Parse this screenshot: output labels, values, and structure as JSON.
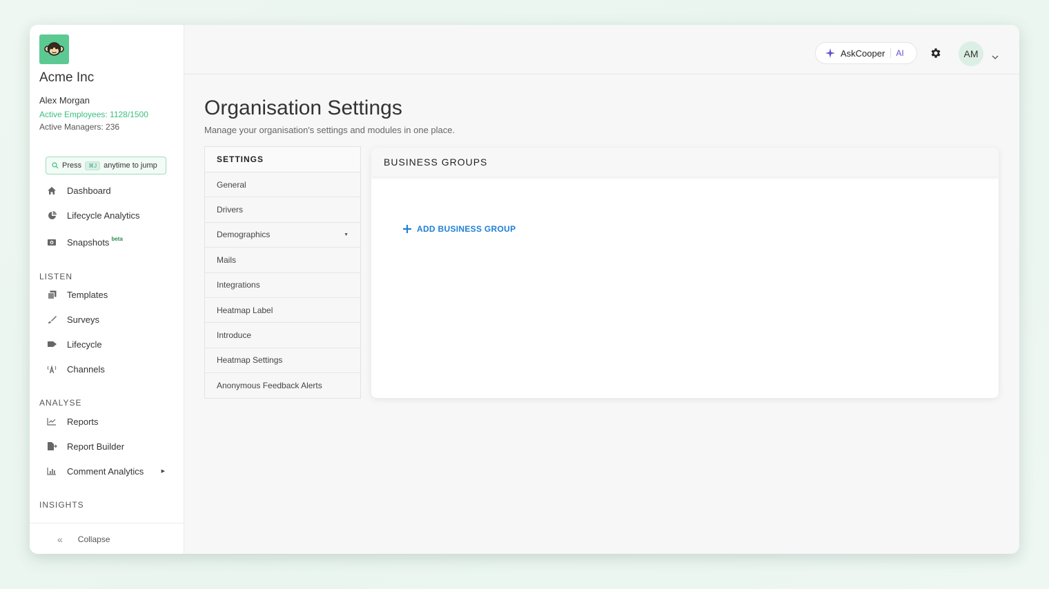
{
  "sidebar": {
    "org_name": "Acme Inc",
    "user_name": "Alex Morgan",
    "active_employees": "Active Employees: 1128/1500",
    "active_managers": "Active Managers: 236",
    "jump": {
      "press": "Press",
      "shortcut": "⌘J",
      "suffix": "anytime to jump"
    },
    "nav": [
      {
        "label": "Dashboard",
        "icon": "home-icon"
      },
      {
        "label": "Lifecycle Analytics",
        "icon": "pie-icon"
      },
      {
        "label": "Snapshots",
        "badge": "beta",
        "icon": "camera-icon"
      }
    ],
    "sections": {
      "listen": {
        "title": "LISTEN",
        "items": [
          {
            "label": "Templates",
            "icon": "copy-icon"
          },
          {
            "label": "Surveys",
            "icon": "brush-icon"
          },
          {
            "label": "Lifecycle",
            "icon": "flag-icon"
          },
          {
            "label": "Channels",
            "icon": "broadcast-icon"
          }
        ]
      },
      "analyse": {
        "title": "ANALYSE",
        "items": [
          {
            "label": "Reports",
            "icon": "line-chart-icon"
          },
          {
            "label": "Report Builder",
            "icon": "file-export-icon"
          },
          {
            "label": "Comment Analytics",
            "icon": "bar-chart-icon"
          }
        ]
      },
      "insights": {
        "title": "INSIGHTS"
      }
    },
    "collapse_label": "Collapse"
  },
  "topbar": {
    "askcooper": "AskCooper",
    "ai": "AI",
    "avatar": "AM"
  },
  "main": {
    "title": "Organisation Settings",
    "subtitle": "Manage your organisation's settings and modules in one place.",
    "settings_menu": {
      "header": "SETTINGS",
      "items": [
        "General",
        "Drivers",
        "Demographics",
        "Mails",
        "Integrations",
        "Heatmap Label",
        "Introduce",
        "Heatmap Settings",
        "Anonymous Feedback Alerts"
      ]
    },
    "panel": {
      "title": "BUSINESS GROUPS",
      "add_label": "ADD BUSINESS GROUP"
    }
  },
  "colors": {
    "accent_green": "#3bbf7f",
    "link_blue": "#1e7fd4",
    "ai_purple": "#5b4ed6"
  }
}
